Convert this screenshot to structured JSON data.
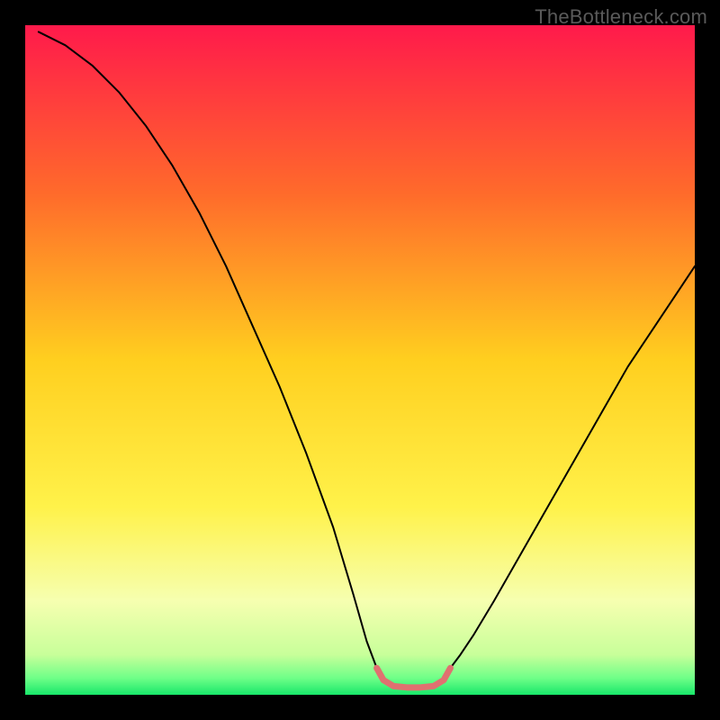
{
  "watermark": "TheBottleneck.com",
  "chart_data": {
    "type": "line",
    "title": "",
    "xlabel": "",
    "ylabel": "",
    "xlim": [
      0,
      100
    ],
    "ylim": [
      0,
      100
    ],
    "grid": false,
    "legend": false,
    "series": [
      {
        "name": "curve-left",
        "stroke": "#000000",
        "stroke_width": 2,
        "x": [
          2,
          6,
          10,
          14,
          18,
          22,
          26,
          30,
          34,
          38,
          42,
          46,
          49,
          51,
          52.5
        ],
        "values": [
          99,
          97,
          94,
          90,
          85,
          79,
          72,
          64,
          55,
          46,
          36,
          25,
          15,
          8,
          4
        ]
      },
      {
        "name": "curve-right",
        "stroke": "#000000",
        "stroke_width": 2,
        "x": [
          63.5,
          65,
          67,
          70,
          74,
          78,
          82,
          86,
          90,
          94,
          98,
          100
        ],
        "values": [
          4,
          6,
          9,
          14,
          21,
          28,
          35,
          42,
          49,
          55,
          61,
          64
        ]
      },
      {
        "name": "flat-bottom",
        "stroke": "#e07070",
        "stroke_width": 7,
        "x": [
          52.5,
          53.5,
          55,
          57,
          59,
          61,
          62.5,
          63.5
        ],
        "values": [
          4.0,
          2.2,
          1.3,
          1.1,
          1.1,
          1.3,
          2.2,
          4.0
        ]
      }
    ],
    "background_gradient": {
      "type": "vertical",
      "stops": [
        {
          "offset": 0.0,
          "color": "#ff1a4b"
        },
        {
          "offset": 0.25,
          "color": "#ff6a2b"
        },
        {
          "offset": 0.5,
          "color": "#ffcf1f"
        },
        {
          "offset": 0.72,
          "color": "#fff24a"
        },
        {
          "offset": 0.86,
          "color": "#f6ffb0"
        },
        {
          "offset": 0.94,
          "color": "#c8ff9a"
        },
        {
          "offset": 0.975,
          "color": "#6fff88"
        },
        {
          "offset": 1.0,
          "color": "#18e76a"
        }
      ]
    }
  }
}
